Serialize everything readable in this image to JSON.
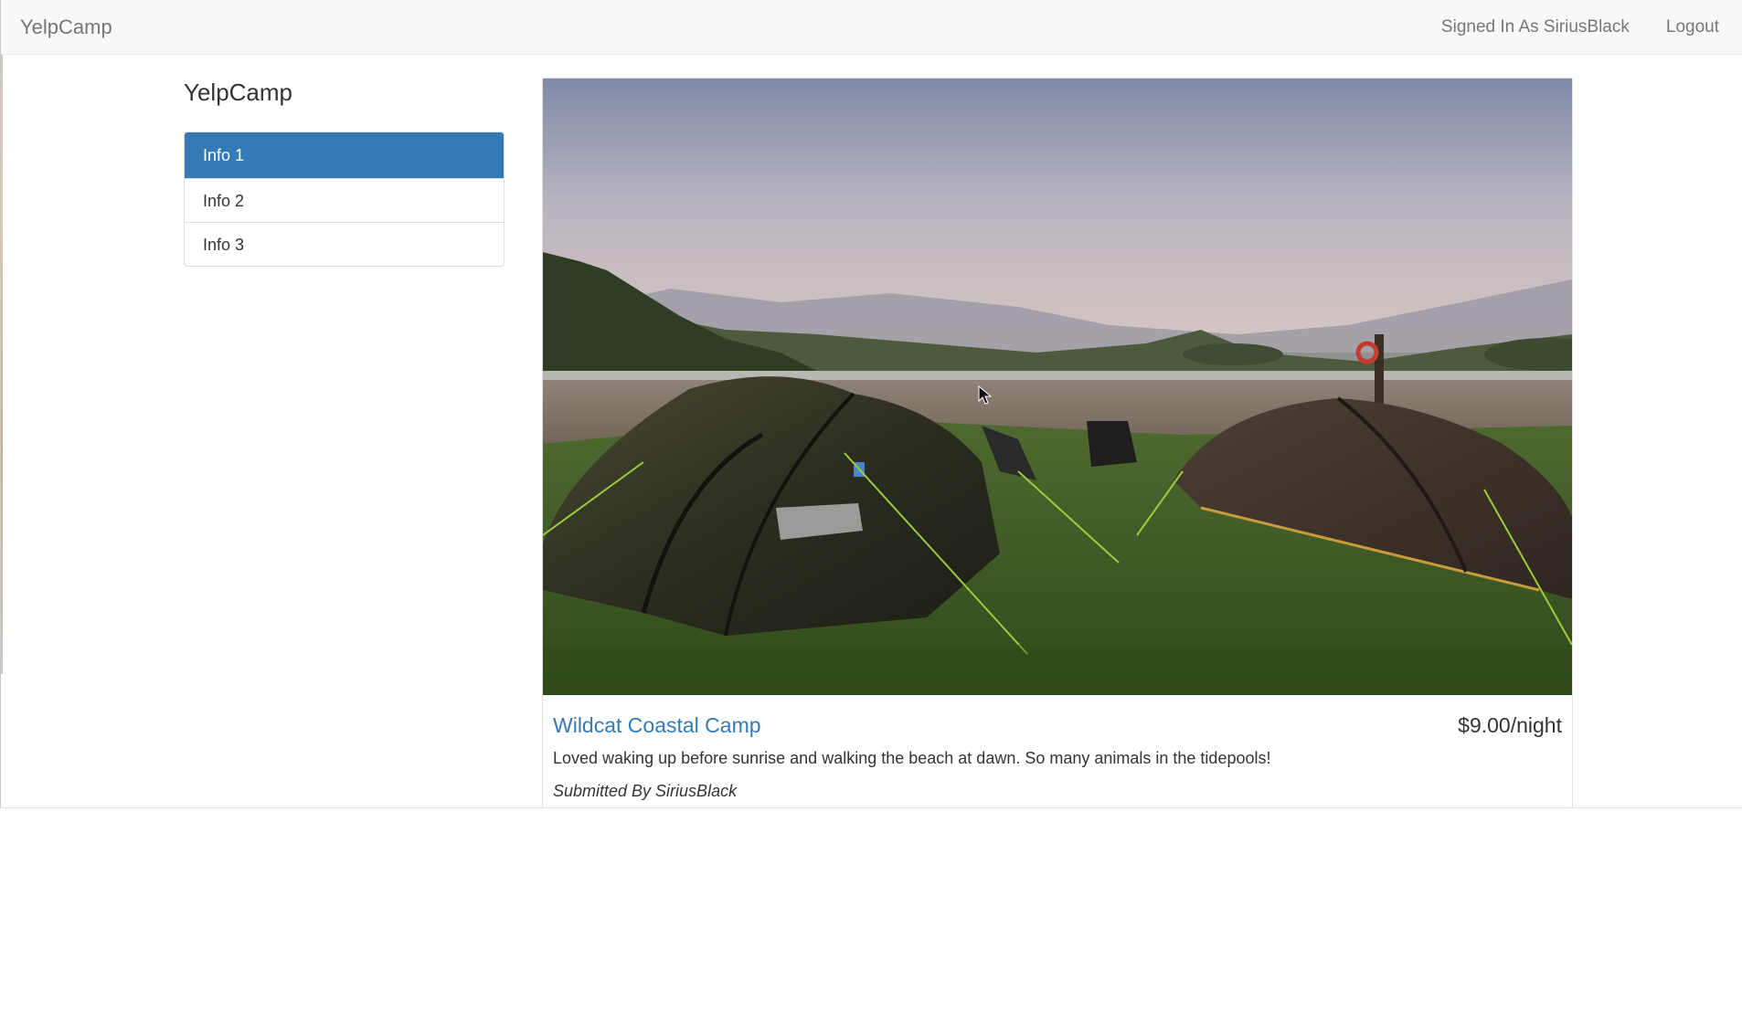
{
  "navbar": {
    "brand": "YelpCamp",
    "signed_in": "Signed In As SiriusBlack",
    "logout": "Logout"
  },
  "sidebar": {
    "title": "YelpCamp",
    "items": [
      {
        "label": "Info 1",
        "active": true
      },
      {
        "label": "Info 2",
        "active": false
      },
      {
        "label": "Info 3",
        "active": false
      }
    ]
  },
  "campground": {
    "name": "Wildcat Coastal Camp",
    "price": "$9.00/night",
    "description": "Loved waking up before sunrise and walking the beach at dawn. So many animals in the tidepools!",
    "author": "Submitted By SiriusBlack"
  },
  "colors": {
    "primary": "#337ab7",
    "navbar_bg": "#f8f8f8",
    "text": "#333333",
    "muted": "#777777"
  }
}
